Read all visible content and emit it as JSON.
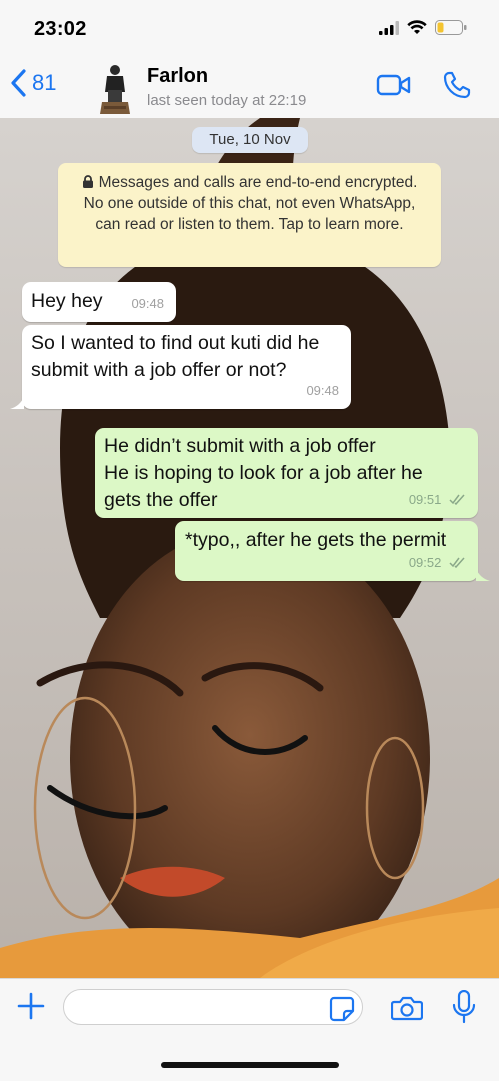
{
  "status_bar": {
    "time": "23:02"
  },
  "header": {
    "back_count": "81",
    "contact_name": "Farlon",
    "contact_status": "last seen today at 22:19"
  },
  "chat": {
    "date_label": "Tue, 10 Nov",
    "encryption_notice": "Messages and calls are end-to-end encrypted. No one outside of this chat, not even WhatsApp, can read or listen to them. Tap to learn more.",
    "messages": [
      {
        "direction": "incoming",
        "text": "Hey hey",
        "time": "09:48"
      },
      {
        "direction": "incoming",
        "text": "So I wanted to find out kuti did he\nsubmit with a job offer or not?",
        "time": "09:48"
      },
      {
        "direction": "outgoing",
        "text": "He didn’t submit with a job offer\nHe is hoping to look for a job after he\ngets the offer",
        "time": "09:51",
        "status": "read"
      },
      {
        "direction": "outgoing",
        "text": "*typo,, after he gets the permit",
        "time": "09:52",
        "status": "read"
      }
    ]
  },
  "input_bar": {
    "message_value": "",
    "placeholder": ""
  },
  "colors": {
    "accent": "#1c76f0",
    "incoming_bubble": "#ffffff",
    "outgoing_bubble": "#dcf8c6",
    "notice_bg": "#fbf3c9",
    "date_pill_bg": "#dde6f4"
  },
  "icons": [
    "signal-icon",
    "wifi-icon",
    "battery-icon",
    "chevron-left-icon",
    "video-call-icon",
    "phone-icon",
    "lock-icon",
    "double-check-icon",
    "plus-icon",
    "sticker-icon",
    "camera-icon",
    "microphone-icon"
  ]
}
